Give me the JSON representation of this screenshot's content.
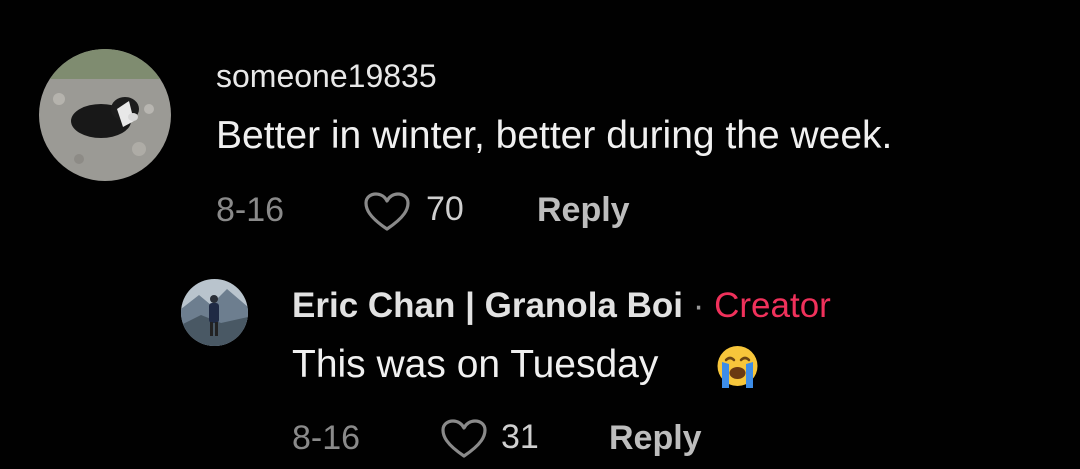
{
  "comments": [
    {
      "username": "someone19835",
      "text": "Better in winter, better during the week.",
      "date": "8-16",
      "likes": "70",
      "reply_label": "Reply",
      "avatar": "dog-on-gravel-avatar"
    },
    {
      "username": "Eric Chan | Granola Boi",
      "separator": "·",
      "badge": "Creator",
      "text": "This was on Tuesday",
      "emoji": "loudly-crying-face-icon",
      "date": "8-16",
      "likes": "31",
      "reply_label": "Reply",
      "avatar": "person-mountain-avatar"
    }
  ],
  "colors": {
    "background": "#010101",
    "creator_badge": "#f0315b",
    "muted": "#8a8a8a"
  }
}
